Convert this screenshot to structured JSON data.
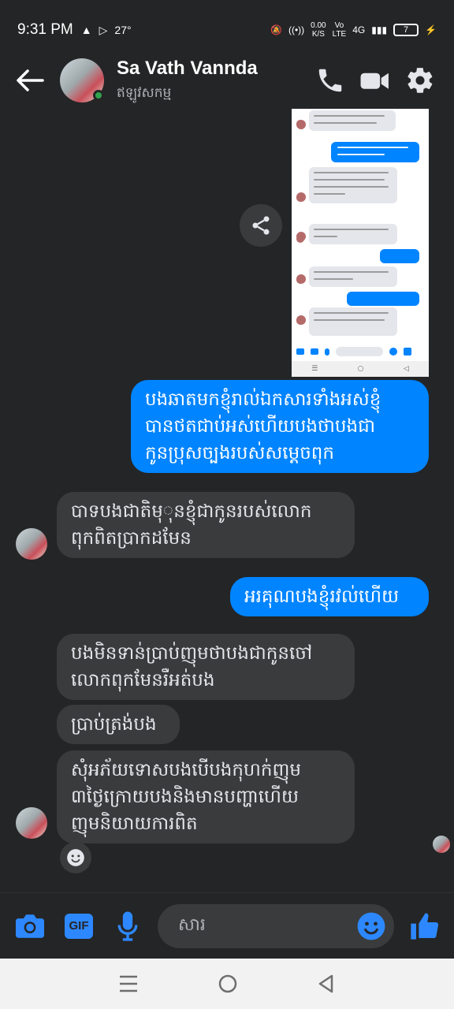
{
  "status_bar": {
    "time": "9:31 PM",
    "temperature": "27°",
    "speed_value": "0.00",
    "speed_unit": "K/S",
    "vo_lte_top": "Vo",
    "vo_lte_bottom": "LTE",
    "network": "4G",
    "battery": "7"
  },
  "header": {
    "contact_name": "Sa Vath Vannda",
    "contact_status": "ឥឡូវសកម្ម"
  },
  "messages": [
    {
      "dir": "out",
      "lines": [
        "បងឆាតមកខ្ញុំរាល់ឯកសារទាំងអស់ខ្ញុំ",
        "បានថតជាប់អស់ហើយបងថាបងជា",
        "កូនប្រុសច្បងរបស់សម្តេចពុក"
      ]
    },
    {
      "dir": "in",
      "lines": [
        "បាទបងជាតិមុុនខ្ញុំជាកូនរបស់លោក",
        "ពុកពិតប្រាកដមែន"
      ]
    },
    {
      "dir": "out",
      "lines": [
        "អរគុណបងខ្ញុំរវល់ហើយ"
      ]
    },
    {
      "dir": "in",
      "lines": [
        "បងមិនទាន់ប្រាប់ញុមថាបងជាកូនចៅ",
        "លោកពុកមែនរឺអត់បង"
      ]
    },
    {
      "dir": "in",
      "lines": [
        "ប្រាប់ត្រង់បង"
      ]
    },
    {
      "dir": "in",
      "lines": [
        "សុំអភ័យទោសបងបើបងកុហក់ញុម",
        "៣ថ្ងៃក្រោយបងនិងមានបញ្ហាហើយ",
        "ញុមនិយាយការពិត"
      ]
    }
  ],
  "composer": {
    "gif_label": "GIF",
    "placeholder": "សារ"
  },
  "colors": {
    "accent": "#0084ff",
    "incoming_bubble": "#3a3b3c",
    "background": "#242526"
  }
}
